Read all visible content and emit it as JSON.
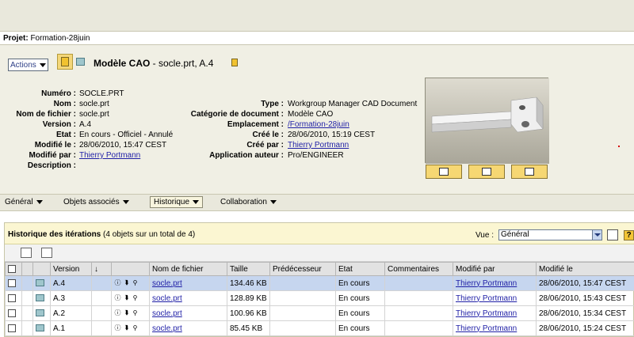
{
  "project": {
    "label": "Projet:",
    "name": "Formation-28juin"
  },
  "header": {
    "actions_label": "Actions",
    "title_bold": "Modèle CAO",
    "title_rest": " - socle.prt, A.4"
  },
  "attributes_left": [
    {
      "label": "Numéro :",
      "value": "SOCLE.PRT"
    },
    {
      "label": "Nom :",
      "value": "socle.prt"
    },
    {
      "label": "Nom de fichier :",
      "value": "socle.prt"
    },
    {
      "label": "Version :",
      "value": "A.4"
    },
    {
      "label": "Etat :",
      "value": "En cours - Officiel - Annulé"
    },
    {
      "label": "Modifié le :",
      "value": "28/06/2010, 15:47 CEST"
    },
    {
      "label": "Modifié par :",
      "value": "Thierry Portmann"
    },
    {
      "label": "Description :",
      "value": ""
    }
  ],
  "attributes_right": [
    {
      "label": "Type :",
      "value": "Workgroup Manager CAD Document"
    },
    {
      "label": "Catégorie de document :",
      "value": "Modèle CAO"
    },
    {
      "label": "Emplacement :",
      "value": "/Formation-28juin"
    },
    {
      "label": "Créé le :",
      "value": "28/06/2010, 15:19 CEST"
    },
    {
      "label": "Créé par :",
      "value": "Thierry Portmann"
    },
    {
      "label": "Application auteur :",
      "value": "Pro/ENGINEER"
    }
  ],
  "tabs": [
    "Général",
    "Objets associés",
    "Historique",
    "Collaboration"
  ],
  "history": {
    "title_bold": "Historique des itérations",
    "title_count": " (4 objets sur un total de 4)",
    "view_label": "Vue :",
    "view_value": "Général",
    "help": "?",
    "columns": [
      "Version",
      "Nom de fichier",
      "Taille",
      "Prédécesseur",
      "Etat",
      "Commentaires",
      "Modifié par",
      "Modifié le"
    ],
    "sort_indicator": "↓",
    "rows": [
      {
        "version": "A.4",
        "file": "socle.prt",
        "size": "134.46 KB",
        "pred": "",
        "state": "En cours",
        "comment": "",
        "by": "Thierry Portmann",
        "date": "28/06/2010, 15:47 CEST"
      },
      {
        "version": "A.3",
        "file": "socle.prt",
        "size": "128.89 KB",
        "pred": "",
        "state": "En cours",
        "comment": "",
        "by": "Thierry Portmann",
        "date": "28/06/2010, 15:43 CEST"
      },
      {
        "version": "A.2",
        "file": "socle.prt",
        "size": "100.96 KB",
        "pred": "",
        "state": "En cours",
        "comment": "",
        "by": "Thierry Portmann",
        "date": "28/06/2010, 15:34 CEST"
      },
      {
        "version": "A.1",
        "file": "socle.prt",
        "size": "85.45 KB",
        "pred": "",
        "state": "En cours",
        "comment": "",
        "by": "Thierry Portmann",
        "date": "28/06/2010, 15:24 CEST"
      }
    ]
  }
}
